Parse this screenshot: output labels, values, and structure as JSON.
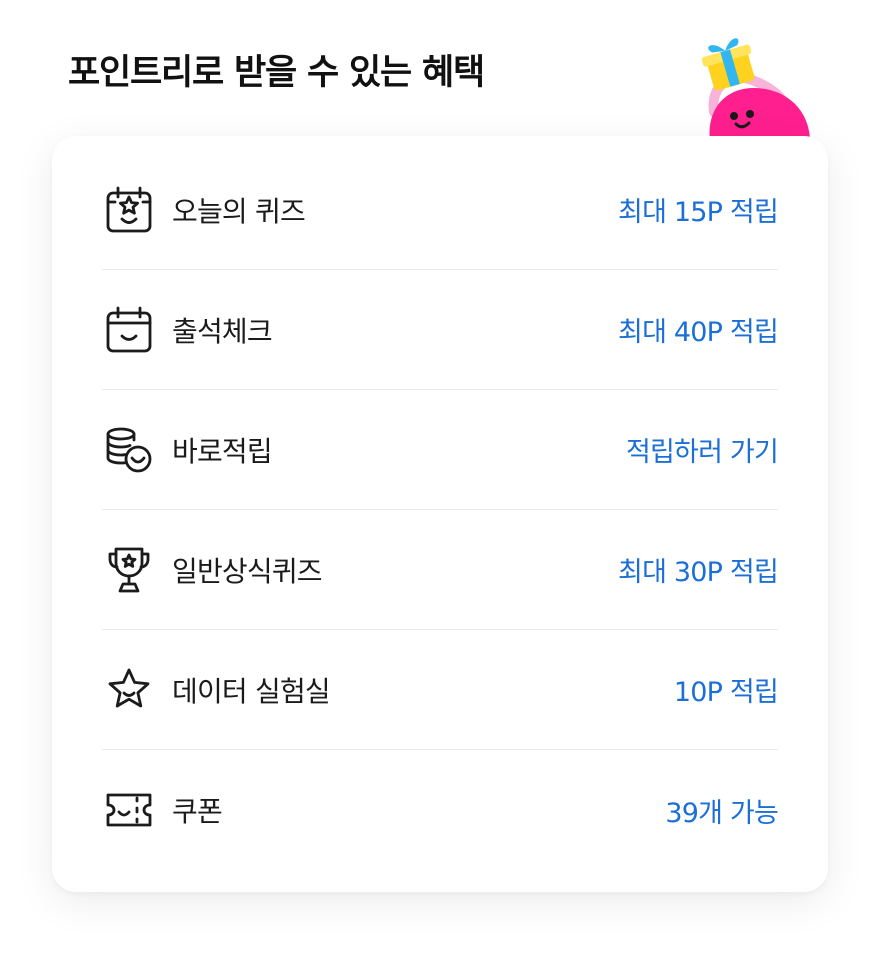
{
  "page": {
    "title": "포인트리로 받을 수 있는 혜택",
    "accent_color": "#1c6fd6",
    "mascot": "pink-character-with-gift-icon"
  },
  "benefits": [
    {
      "icon": "quiz-calendar-star-icon",
      "label": "오늘의 퀴즈",
      "reward": "최대 15P 적립"
    },
    {
      "icon": "calendar-check-icon",
      "label": "출석체크",
      "reward": "최대 40P 적립"
    },
    {
      "icon": "coins-stack-icon",
      "label": "바로적립",
      "reward": "적립하러 가기"
    },
    {
      "icon": "trophy-icon",
      "label": "일반상식퀴즈",
      "reward": "최대 30P 적립"
    },
    {
      "icon": "star-icon",
      "label": "데이터 실험실",
      "reward": "10P 적립"
    },
    {
      "icon": "coupon-ticket-icon",
      "label": "쿠폰",
      "reward": "39개 가능"
    }
  ]
}
